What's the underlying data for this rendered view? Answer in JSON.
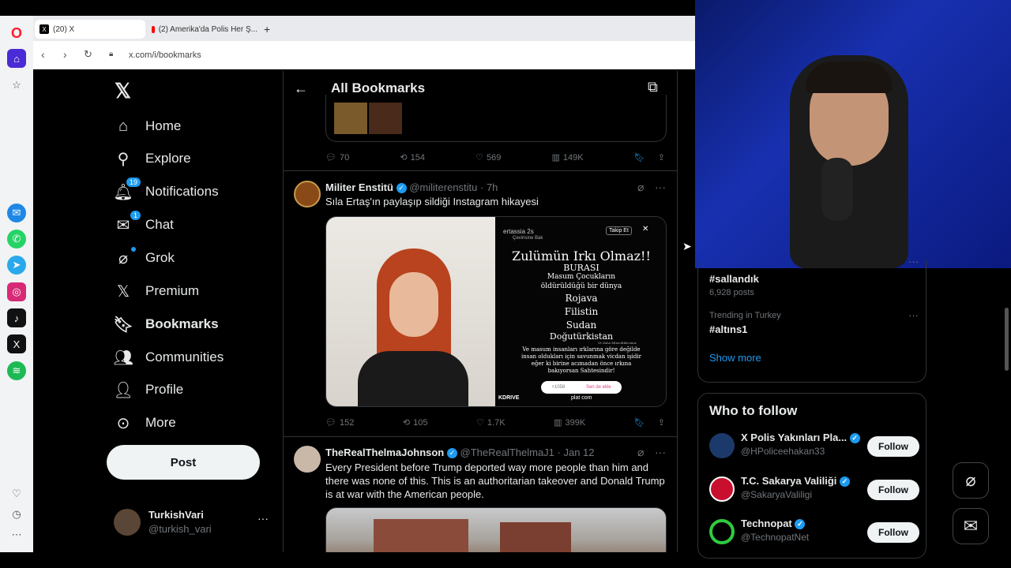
{
  "browser": {
    "tabs": [
      {
        "label": "(20) X"
      },
      {
        "label": "(2) Amerika'da Polis Her Ş..."
      }
    ],
    "new_tab": "+",
    "url": "x.com/i/bookmarks"
  },
  "nav": {
    "items": [
      {
        "label": "Home"
      },
      {
        "label": "Explore"
      },
      {
        "label": "Notifications",
        "badge": "19"
      },
      {
        "label": "Chat",
        "badge": "1"
      },
      {
        "label": "Grok"
      },
      {
        "label": "Premium"
      },
      {
        "label": "Bookmarks"
      },
      {
        "label": "Communities"
      },
      {
        "label": "Profile"
      },
      {
        "label": "More"
      }
    ],
    "post_button": "Post",
    "account": {
      "name": "TurkishVari",
      "handle": "@turkish_vari"
    }
  },
  "header": {
    "title": "All Bookmarks"
  },
  "tweets": [
    {
      "replies": "70",
      "reposts": "154",
      "likes": "569",
      "views": "149K"
    },
    {
      "name": "Militer Enstitü",
      "handle": "@militerenstitu",
      "time": "· 7h",
      "text": "Sıla Ertaş'ın paylaşıp sildiği Instagram hikayesi",
      "image": {
        "user": "ertassia",
        "time": "2s",
        "follow": "Takip Et",
        "translate": "Çevirisine Bak",
        "headline": "Zulümün Irkı Olmaz!!",
        "lines": [
          "BURASI",
          "Masum Çocukların",
          "öldürüldüğü bir dünya"
        ],
        "places": [
          "Rojava",
          "Filistin",
          "Sudan",
          "Doğutürkistan"
        ],
        "small_note": "Ve daha bilmediklerimiz",
        "body": "Ve masum insanları ırklarına göre değilde insan oldukları için savunmak vicdan işidir eğer ki birine acımadan önce ırkına bakıyorsan Sahtesindir!",
        "counter": "+1058",
        "add_label": "Sen de ekle",
        "brand1": "KDRIVE",
        "brand2": "plat com"
      },
      "replies": "152",
      "reposts": "105",
      "likes": "1.7K",
      "views": "399K"
    },
    {
      "name": "TheRealThelmaJohnson",
      "handle": "@TheRealThelmaJ1",
      "time": "· Jan 12",
      "text": "Every President before Trump deported way more people than him and there was none of this.  This is an authoritarian takeover and   Donald Trump is at war with the American people."
    }
  ],
  "trends": [
    {
      "context": "Trending in Turkey",
      "tag": "#sallandık",
      "posts": "6,928 posts"
    },
    {
      "context": "Trending in Turkey",
      "tag": "#altıns1"
    }
  ],
  "show_more": "Show more",
  "who_to_follow": {
    "title": "Who to follow",
    "accounts": [
      {
        "name": "X Polis Yakınları Pla...",
        "handle": "@HPoliceehakan33",
        "button": "Follow"
      },
      {
        "name": "T.C. Sakarya Valiliği",
        "handle": "@SakaryaValiligi",
        "button": "Follow"
      },
      {
        "name": "Technopat",
        "handle": "@TechnopatNet",
        "button": "Follow"
      }
    ]
  },
  "colors": {
    "accent": "#1d9bf0",
    "background": "#000000",
    "opera": "#ff1b2d"
  }
}
